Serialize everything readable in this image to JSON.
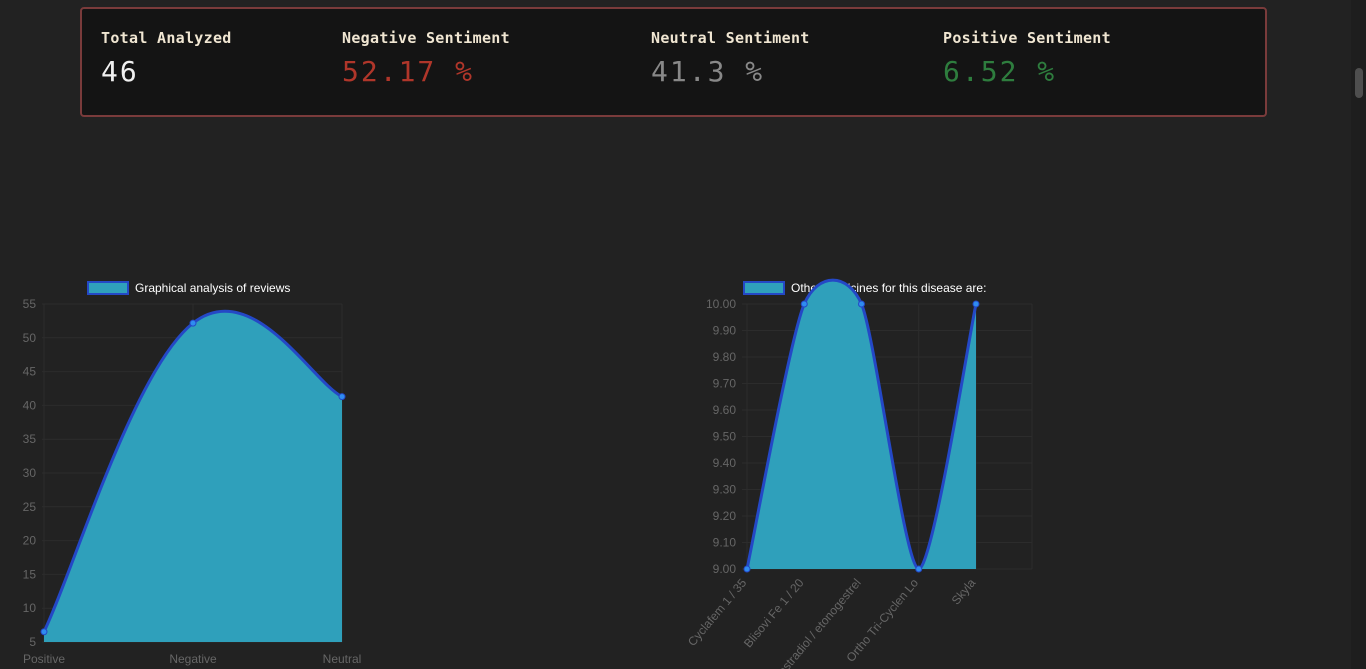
{
  "stats": {
    "total": {
      "label": "Total Analyzed",
      "value": "46",
      "color": "#f0f0f0"
    },
    "negative": {
      "label": "Negative Sentiment",
      "value": "52.17 %",
      "color": "#b0362a"
    },
    "neutral": {
      "label": "Neutral Sentiment",
      "value": "41.3 %",
      "color": "#888888"
    },
    "positive": {
      "label": "Positive Sentiment",
      "value": "6.52 %",
      "color": "#2e7d3e"
    }
  },
  "colors": {
    "fill": "#2fa0bb",
    "line": "#2448c6",
    "point": "#2f8cf0",
    "card_border": "#7a3b3b"
  },
  "chart_data": [
    {
      "type": "area",
      "legend": "Graphical analysis of reviews",
      "categories": [
        "Positive",
        "Negative",
        "Neutral"
      ],
      "values": [
        6.52,
        52.17,
        41.3
      ],
      "ylim": [
        5,
        55
      ],
      "yticks": [
        5,
        10,
        15,
        20,
        25,
        30,
        35,
        40,
        45,
        50,
        55
      ],
      "grid": true,
      "legend_position": "top"
    },
    {
      "type": "area",
      "legend": "Other medicines for this disease are:",
      "categories": [
        "Cyclafem 1 / 35",
        "Blisovi Fe 1 / 20",
        "estradiol / etonogestrel",
        "Ortho Tri-Cyclen Lo",
        "Skyla"
      ],
      "values": [
        9.0,
        10.0,
        10.0,
        9.0,
        10.0
      ],
      "ylim": [
        9.0,
        10.0
      ],
      "yticks": [
        "9.00",
        "9.10",
        "9.20",
        "9.30",
        "9.40",
        "9.50",
        "9.60",
        "9.70",
        "9.80",
        "9.90",
        "10.00"
      ],
      "grid": true,
      "legend_position": "top"
    }
  ]
}
